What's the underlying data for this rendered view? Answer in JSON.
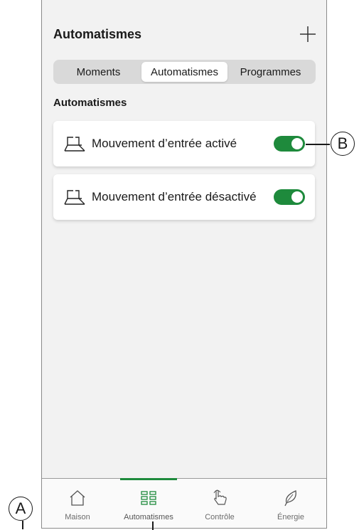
{
  "header": {
    "title": "Automatismes",
    "add_icon": "plus-icon"
  },
  "segments": [
    {
      "label": "Moments",
      "active": false
    },
    {
      "label": "Automatismes",
      "active": true
    },
    {
      "label": "Programmes",
      "active": false
    }
  ],
  "section": {
    "title": "Automatismes"
  },
  "automations": [
    {
      "label": "Mouvement d’entrée activé",
      "enabled": true,
      "icon": "shutter-icon"
    },
    {
      "label": "Mouvement d’entrée désactivé",
      "enabled": true,
      "icon": "shutter-icon"
    }
  ],
  "tabs": [
    {
      "label": "Maison",
      "icon": "home-icon",
      "active": false
    },
    {
      "label": "Automatismes",
      "icon": "grid-icon",
      "active": true
    },
    {
      "label": "Contrôle",
      "icon": "hand-tap-icon",
      "active": false
    },
    {
      "label": "Énergie",
      "icon": "leaf-icon",
      "active": false
    }
  ],
  "callouts": {
    "a": "A",
    "b": "B"
  },
  "colors": {
    "accent": "#1e8a3c",
    "background": "#f2f2f2",
    "card": "#ffffff"
  }
}
